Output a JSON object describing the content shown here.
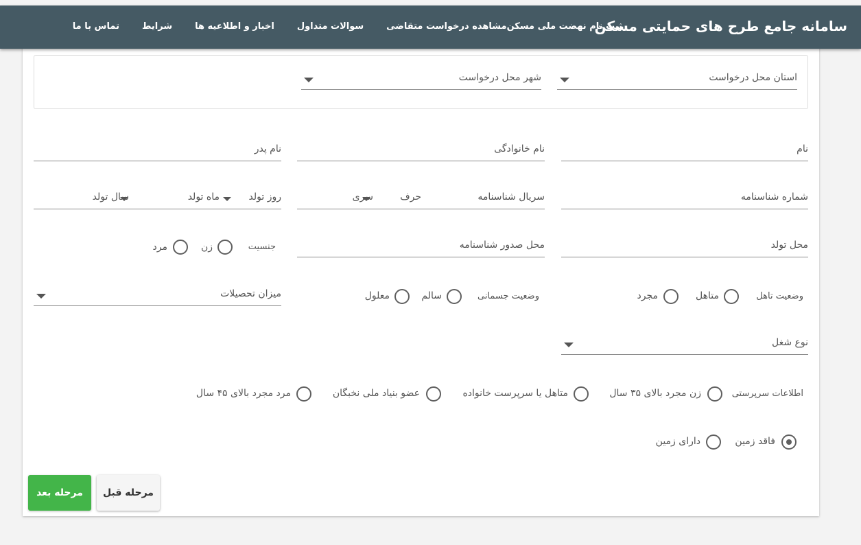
{
  "header": {
    "title": "سامانه جامع طرح های حمایتی مسکن",
    "nav": [
      "ثبت نام نهضت ملی مسکن",
      "مشاهده درخواست متقاضی",
      "سوالات متداول",
      "اخبار و اطلاعیه ها",
      "شرایط",
      "تماس با ما"
    ]
  },
  "location": {
    "province_label": "استان محل درخواست",
    "city_label": "شهر محل درخواست"
  },
  "fields": {
    "first_name": "نام",
    "last_name": "نام خانوادگی",
    "father_name": "نام پدر",
    "id_number": "شماره شناسنامه",
    "id_serial": "سریال شناسنامه",
    "id_letter": "حرف",
    "id_series": "سری",
    "birth_day": "روز تولد",
    "birth_month": "ماه تولد",
    "birth_year": "سال تولد",
    "birth_place": "محل تولد",
    "issue_place": "محل صدور شناسنامه",
    "education": "میزان تحصیلات",
    "job_type": "نوع شغل"
  },
  "gender": {
    "label": "جنسیت",
    "options": [
      "زن",
      "مرد"
    ]
  },
  "marital": {
    "label": "وضعیت تاهل",
    "options": [
      "متاهل",
      "مجرد"
    ]
  },
  "physical": {
    "label": "وضعیت جسمانی",
    "options": [
      "سالم",
      "معلول"
    ]
  },
  "guardianship": {
    "label": "اطلاعات سرپرستی",
    "options": [
      "زن مجرد بالای ۳۵ سال",
      "متاهل یا سرپرست خانواده",
      "عضو بنیاد ملی نخبگان",
      "مرد مجرد بالای ۴۵ سال"
    ]
  },
  "land": {
    "options": [
      "فاقد زمین",
      "دارای زمین"
    ],
    "selected": "فاقد زمین"
  },
  "buttons": {
    "next": "مرحله بعد",
    "prev": "مرحله قبل"
  }
}
